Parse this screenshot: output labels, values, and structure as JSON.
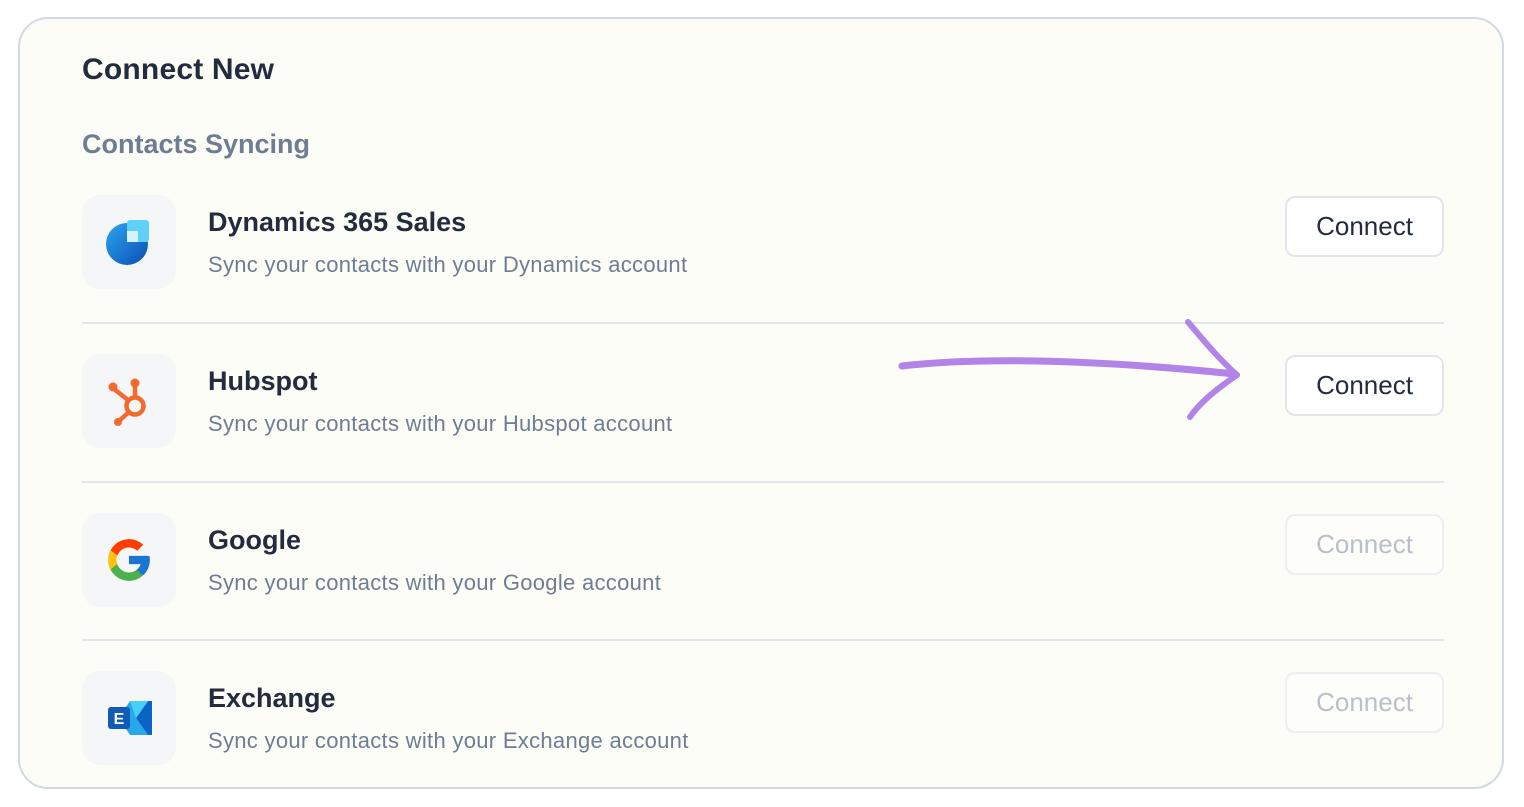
{
  "panel": {
    "title": "Connect New",
    "section_title": "Contacts Syncing"
  },
  "integrations": [
    {
      "name": "Dynamics 365 Sales",
      "description": "Sync your contacts with your Dynamics account",
      "button_label": "Connect",
      "enabled": true,
      "icon": "dynamics-365-logo"
    },
    {
      "name": "Hubspot",
      "description": "Sync your contacts with your Hubspot account",
      "button_label": "Connect",
      "enabled": true,
      "icon": "hubspot-logo"
    },
    {
      "name": "Google",
      "description": "Sync your contacts with your Google account",
      "button_label": "Connect",
      "enabled": false,
      "icon": "google-logo"
    },
    {
      "name": "Exchange",
      "description": "Sync your contacts with your Exchange account",
      "button_label": "Connect",
      "enabled": false,
      "icon": "exchange-logo"
    }
  ],
  "annotation": {
    "icon": "purple-arrow-icon",
    "color": "#b384e8"
  },
  "colors": {
    "panel_background": "#fdfdf8",
    "panel_border": "#d3d9e2",
    "text_primary": "#232c3d",
    "text_secondary": "#6e7d92",
    "button_disabled_text": "#b9c0ca",
    "hubspot_orange": "#f26a2e",
    "dynamics_blue": "#1a6fd8",
    "exchange_blue": "#1c7fd6"
  }
}
